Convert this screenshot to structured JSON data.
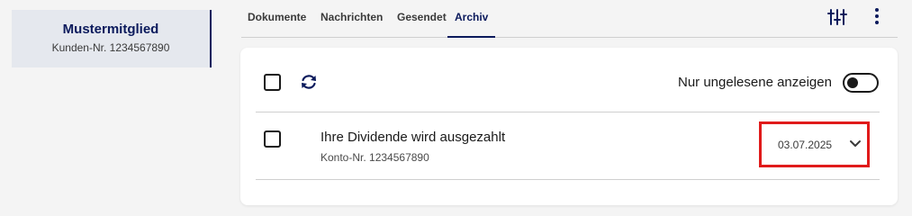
{
  "member": {
    "name": "Mustermitglied",
    "customer_number": "Kunden-Nr. 1234567890"
  },
  "tabs": [
    {
      "label": "Dokumente",
      "active": false
    },
    {
      "label": "Nachrichten",
      "active": false
    },
    {
      "label": "Gesendet",
      "active": false
    },
    {
      "label": "Archiv",
      "active": true
    }
  ],
  "toolbar": {
    "filter_icon": "sliders-icon",
    "more_icon": "more-vertical-icon",
    "refresh_icon": "refresh-icon",
    "unread_only_label": "Nur ungelesene anzeigen",
    "unread_only_enabled": false
  },
  "messages": [
    {
      "title": "Ihre Dividende wird ausgezahlt",
      "account": "Konto-Nr. 1234567890",
      "date": "03.07.2025",
      "expand_icon": "chevron-down-icon"
    }
  ],
  "colors": {
    "accent": "#0b1a5c",
    "highlight_border": "#e01a1a"
  }
}
